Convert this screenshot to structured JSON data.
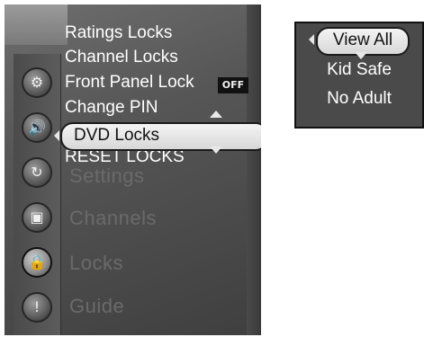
{
  "menu": {
    "items": [
      {
        "label": "Ratings Locks"
      },
      {
        "label": "Channel Locks"
      },
      {
        "label": "Front Panel Lock",
        "badge": "OFF"
      },
      {
        "label": "Change PIN"
      },
      {
        "label": "DVD Locks",
        "selected": true
      },
      {
        "label": "RESET LOCKS"
      }
    ],
    "background_labels": [
      "Settings",
      "Channels",
      "Locks",
      "Guide"
    ],
    "sidebar_icons": [
      {
        "name": "gear-icon",
        "glyph": "⚙"
      },
      {
        "name": "speaker-icon",
        "glyph": "🔊"
      },
      {
        "name": "refresh-icon",
        "glyph": "↻"
      },
      {
        "name": "tv-icon",
        "glyph": "▣"
      },
      {
        "name": "lock-icon",
        "glyph": "🔒",
        "active": true
      },
      {
        "name": "alert-icon",
        "glyph": "!"
      }
    ]
  },
  "options": {
    "items": [
      {
        "label": "View All",
        "selected": true
      },
      {
        "label": "Kid Safe"
      },
      {
        "label": "No Adult"
      }
    ]
  },
  "colors": {
    "panel": "#575757",
    "text": "#ffffff",
    "highlight": "#eeeeee"
  }
}
